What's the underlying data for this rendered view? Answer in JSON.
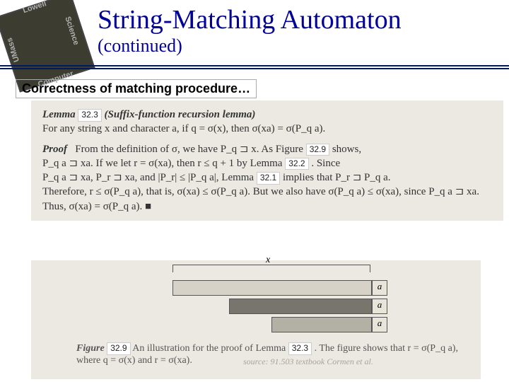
{
  "logo": {
    "t": "Lowell",
    "r": "Science",
    "b": "Computer",
    "l": "UMass"
  },
  "title": "String-Matching Automaton",
  "subtitle": "(continued)",
  "section": "Correctness of matching procedure…",
  "lemma": {
    "num": "32.3",
    "name": "(Suffix-function recursion lemma)",
    "stmt": "For any string x and character a, if q = σ(x), then σ(xa) = σ(P_q a)."
  },
  "proof": {
    "l1a": "From the definition of σ, we have P_q ⊐ x. As Figure",
    "figref": "32.9",
    "l1b": "shows,",
    "l2a": "P_q a ⊐ xa. If we let r = σ(xa), then r ≤ q + 1 by Lemma",
    "lemref1": "32.2",
    "l2b": ". Since",
    "l3a": "P_q a ⊐ xa, P_r ⊐ xa, and |P_r| ≤ |P_q a|, Lemma",
    "lemref2": "32.1",
    "l3b": "implies that P_r ⊐ P_q a.",
    "l4": "Therefore, r ≤ σ(P_q a), that is, σ(xa) ≤ σ(P_q a). But we also have σ(P_q a) ≤ σ(xa), since P_q a ⊐ xa. Thus, σ(xa) = σ(P_q a).   ■"
  },
  "fig": {
    "x": "x",
    "a": "a",
    "num": "32.9",
    "cap_a": "An illustration for the proof of Lemma",
    "cap_lem": "32.3",
    "cap_b": ". The figure shows that r = σ(P_q a), where q = σ(x) and r = σ(xa).",
    "src": "source: 91.503 textbook Cormen et al."
  }
}
